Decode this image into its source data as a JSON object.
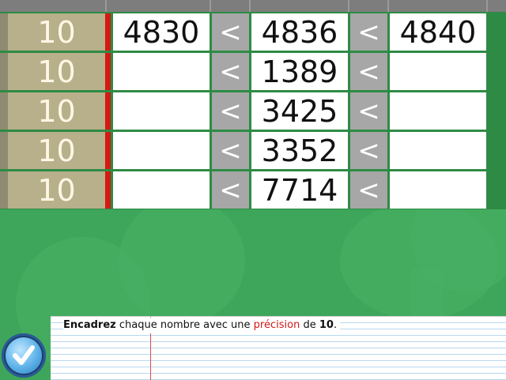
{
  "rows": [
    {
      "precision": "10",
      "lower": "4830",
      "number": "4836",
      "upper": "4840",
      "sym1": "<",
      "sym2": "<"
    },
    {
      "precision": "10",
      "lower": "",
      "number": "1389",
      "upper": "",
      "sym1": "<",
      "sym2": "<"
    },
    {
      "precision": "10",
      "lower": "",
      "number": "3425",
      "upper": "",
      "sym1": "<",
      "sym2": "<"
    },
    {
      "precision": "10",
      "lower": "",
      "number": "3352",
      "upper": "",
      "sym1": "<",
      "sym2": "<"
    },
    {
      "precision": "10",
      "lower": "",
      "number": "7714",
      "upper": "",
      "sym1": "<",
      "sym2": "<"
    }
  ],
  "instruction": {
    "part1": "Encadrez",
    "part2": " chaque nombre avec une ",
    "part3": "précision",
    "part4": " de ",
    "part5": "10",
    "part6": "."
  },
  "icons": {
    "validate": "checkmark-icon"
  },
  "colors": {
    "background": "#3ea65a",
    "precision_cell": "#b7b08a",
    "separator": "#d41a12",
    "symbol_cell": "#a7a7a7",
    "highlight_text": "#d01818"
  }
}
